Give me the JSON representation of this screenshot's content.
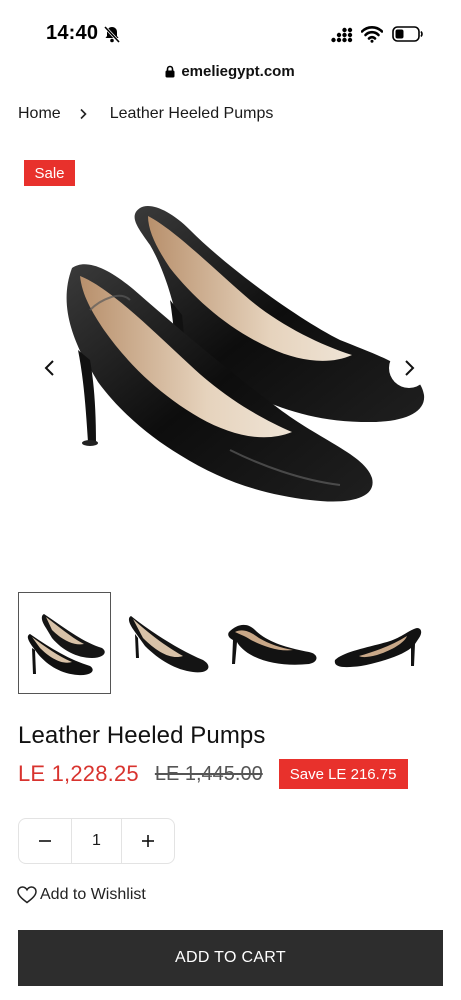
{
  "status_bar": {
    "time": "14:40",
    "url": "emeliegypt.com"
  },
  "breadcrumb": {
    "home": "Home",
    "current": "Leather Heeled Pumps"
  },
  "gallery": {
    "sale_badge": "Sale",
    "thumbnail_count": 4,
    "active_thumbnail": 1
  },
  "product": {
    "title": "Leather Heeled Pumps",
    "price": "LE 1,228.25",
    "compare_price": "LE 1,445.00",
    "save_label": "Save LE 216.75"
  },
  "quantity": {
    "minus": "−",
    "value": "1",
    "plus": "+"
  },
  "wishlist": {
    "label": "Add to Wishlist"
  },
  "cart": {
    "button_label": "ADD TO CART"
  },
  "colors": {
    "sale_red": "#e8312c",
    "price_red": "#d8332e",
    "cart_bg": "#2d2d2d"
  }
}
